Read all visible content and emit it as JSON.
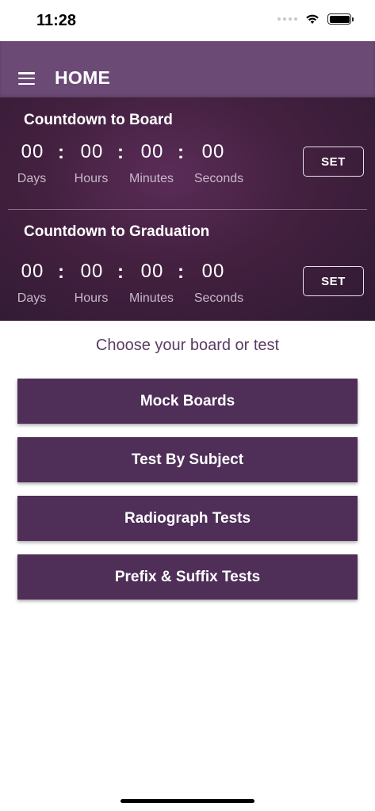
{
  "status_bar": {
    "time": "11:28"
  },
  "header": {
    "title": "HOME",
    "menu_icon": "hamburger-menu-icon"
  },
  "countdowns": [
    {
      "title": "Countdown to Board",
      "days": "00",
      "hours": "00",
      "minutes": "00",
      "seconds": "00",
      "labels": {
        "days": "Days",
        "hours": "Hours",
        "minutes": "Minutes",
        "seconds": "Seconds"
      },
      "set_label": "SET"
    },
    {
      "title": "Countdown to Graduation",
      "days": "00",
      "hours": "00",
      "minutes": "00",
      "seconds": "00",
      "labels": {
        "days": "Days",
        "hours": "Hours",
        "minutes": "Minutes",
        "seconds": "Seconds"
      },
      "set_label": "SET"
    }
  ],
  "separator": ":",
  "choose": {
    "label": "Choose your board or test",
    "buttons": [
      {
        "label": "Mock Boards"
      },
      {
        "label": "Test By Subject"
      },
      {
        "label": "Radiograph Tests"
      },
      {
        "label": "Prefix & Suffix Tests"
      }
    ]
  },
  "colors": {
    "header_bg": "#6c4a76",
    "panel_bg": "#43203f",
    "button_bg": "#4f2e58",
    "label_text": "#5b3d64"
  }
}
